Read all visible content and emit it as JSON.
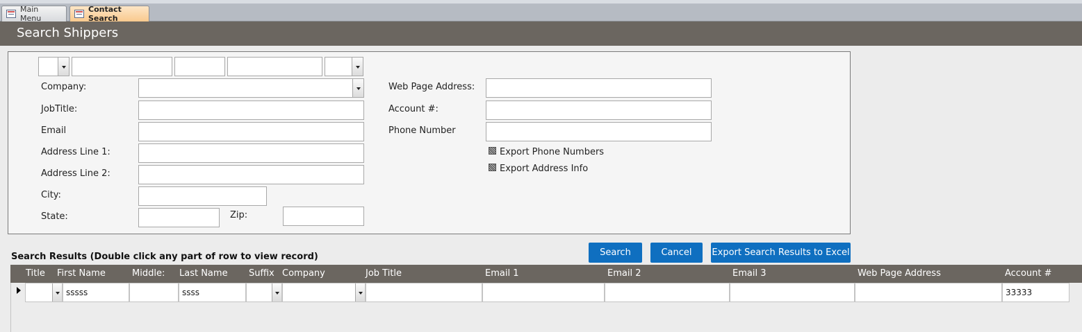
{
  "tabs": [
    {
      "label": "Main Menu",
      "icon": "form-icon",
      "active": false
    },
    {
      "label": "Contact Search",
      "icon": "form-icon",
      "active": true
    }
  ],
  "header": {
    "title": "Search Shippers"
  },
  "form": {
    "company_label": "Company:",
    "jobtitle_label": "JobTitle:",
    "email_label": "Email",
    "address1_label": "Address Line 1:",
    "address2_label": "Address Line 2:",
    "city_label": "City:",
    "state_label": "State:",
    "zip_label": "Zip:",
    "webpage_label": "Web Page Address:",
    "account_label": "Account #:",
    "phone_label": "Phone Number",
    "export_phone_label": "Export Phone Numbers",
    "export_address_label": "Export Address Info"
  },
  "buttons": {
    "search": "Search",
    "cancel": "Cancel",
    "export": "Export Search Results to Excel"
  },
  "results": {
    "caption": "Search Results (Double click any part of row to view record)",
    "columns": [
      "Title",
      "First Name",
      "Middle:",
      "Last Name",
      "Suffix",
      "Company",
      "Job Title",
      "Email 1",
      "Email 2",
      "Email 3",
      "Web Page Address",
      "Account #"
    ],
    "rows": [
      {
        "title": "",
        "first_name": "sssss",
        "middle": "",
        "last_name": "ssss",
        "suffix": "",
        "company": "",
        "job_title": "",
        "email1": "",
        "email2": "",
        "email3": "",
        "web_page": "",
        "account": "33333"
      }
    ]
  },
  "colors": {
    "header_band": "#6b6660",
    "button": "#0f6fc0",
    "active_tab": "#f9c98e"
  }
}
